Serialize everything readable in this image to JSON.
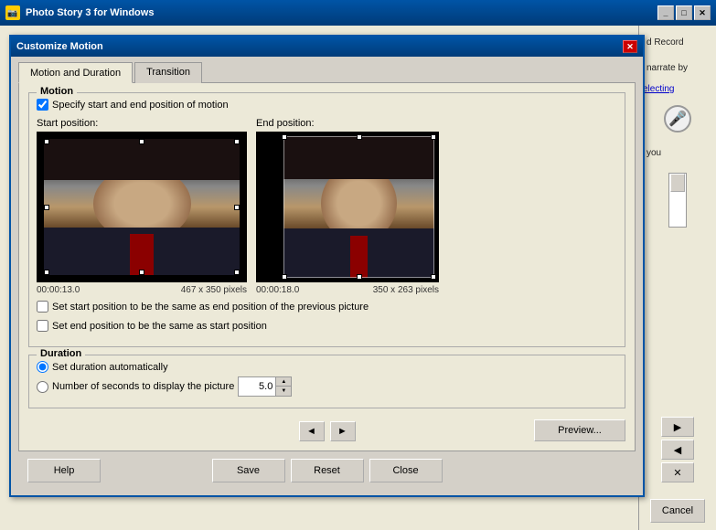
{
  "app": {
    "title": "Photo Story 3 for Windows",
    "icon": "📷"
  },
  "titlebar_buttons": {
    "minimize": "_",
    "maximize": "□",
    "close": "✕"
  },
  "dialog": {
    "title": "Customize Motion",
    "close_label": "✕"
  },
  "tabs": [
    {
      "id": "motion",
      "label": "Motion and Duration",
      "active": true
    },
    {
      "id": "transition",
      "label": "Transition",
      "active": false
    }
  ],
  "motion_group": {
    "label": "Motion",
    "specify_checkbox_label": "Specify start and end position of motion",
    "specify_checked": true
  },
  "start_position": {
    "label": "Start position:",
    "time": "00:00:13.0",
    "size": "467 x 350 pixels"
  },
  "end_position": {
    "label": "End position:",
    "time": "00:00:18.0",
    "size": "350 x 263 pixels"
  },
  "bottom_checks": {
    "same_as_prev_label": "Set start position to be the same as end position of the previous picture",
    "same_as_start_label": "Set end position to be the same as start position"
  },
  "duration_group": {
    "label": "Duration",
    "auto_label": "Set duration automatically",
    "auto_checked": true,
    "seconds_label": "Number of seconds to display the picture",
    "seconds_value": "5.0"
  },
  "nav": {
    "prev": "◄",
    "next": "►"
  },
  "buttons": {
    "help": "Help",
    "preview": "Preview...",
    "save": "Save",
    "reset": "Reset",
    "close": "Close",
    "cancel": "Cancel"
  },
  "right_panel": {
    "record_text": "d Record",
    "narrate_text": "narrate by",
    "selecting_text": "electing",
    "you_text": "you"
  }
}
